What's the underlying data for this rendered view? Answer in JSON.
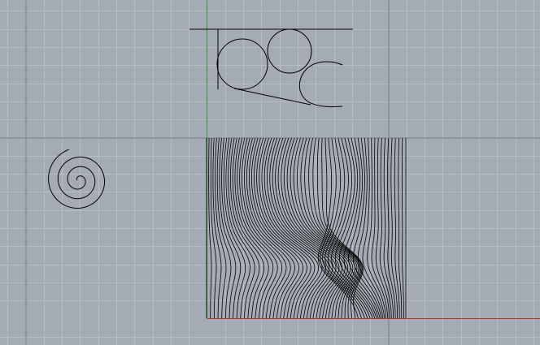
{
  "viewport": {
    "background": "#a5abb4",
    "grid_minor_color": "#b7bdc5",
    "grid_major_color": "#8f959d",
    "x_axis_color": "#c0302a",
    "y_axis_color": "#2f9a3a",
    "curve_color": "#000000"
  },
  "objects": [
    "circles-with-tangent-lines",
    "spiral-curve",
    "contour-line-field"
  ]
}
